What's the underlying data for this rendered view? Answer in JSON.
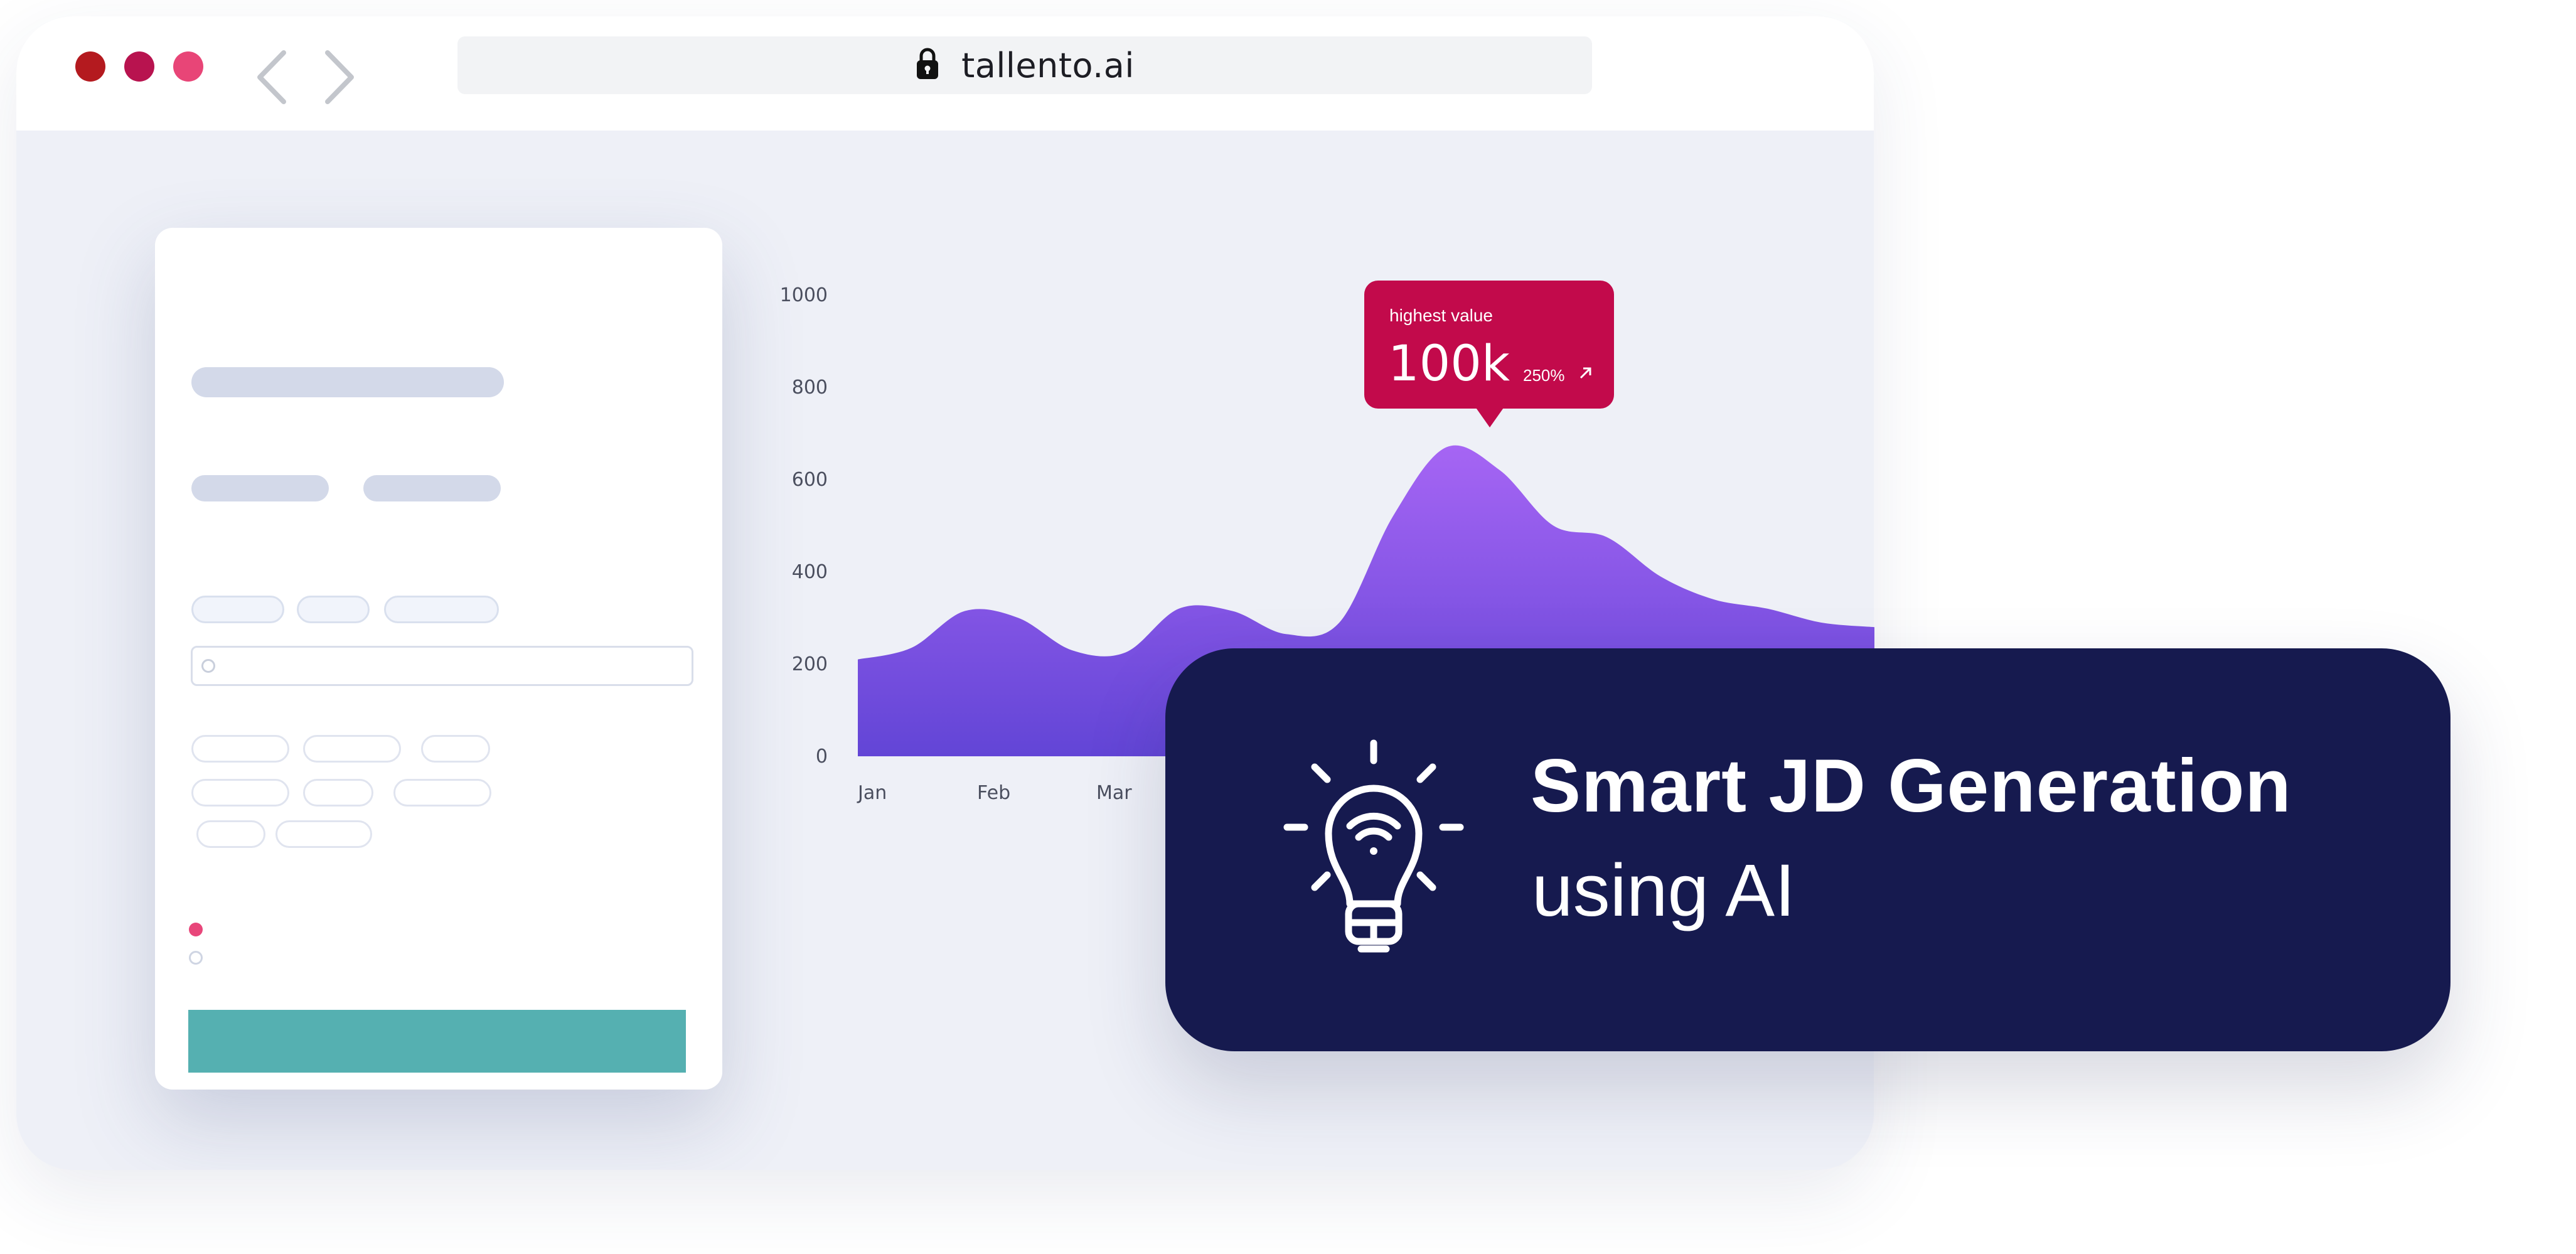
{
  "browser": {
    "url": "tallento.ai",
    "dot_colors": [
      "#b41a1f",
      "#b8134f",
      "#e84577"
    ],
    "lock_icon": "lock-icon"
  },
  "colors": {
    "area_top": "#a665f4",
    "area_bottom": "#6245d6",
    "tooltip": "#c20a4b",
    "submit": "#55b0b1",
    "feature_card": "#161a4f",
    "radio_selected": "#e8467a"
  },
  "chart_data": {
    "type": "area",
    "x": [
      "Jan",
      "Feb",
      "Mar"
    ],
    "y_ticks": [
      "1000",
      "800",
      "600",
      "400",
      "200",
      "0"
    ],
    "ylim": [
      0,
      1000
    ],
    "grid": false,
    "curve_points": [
      {
        "x": 0.0,
        "y": 210
      },
      {
        "x": 0.5,
        "y": 235
      },
      {
        "x": 1.0,
        "y": 315
      },
      {
        "x": 1.5,
        "y": 300
      },
      {
        "x": 2.0,
        "y": 230
      },
      {
        "x": 2.5,
        "y": 225
      },
      {
        "x": 3.0,
        "y": 320
      },
      {
        "x": 3.5,
        "y": 315
      },
      {
        "x": 4.0,
        "y": 265
      },
      {
        "x": 4.5,
        "y": 290
      },
      {
        "x": 5.0,
        "y": 520
      },
      {
        "x": 5.5,
        "y": 670
      },
      {
        "x": 6.0,
        "y": 620
      },
      {
        "x": 6.5,
        "y": 500
      },
      {
        "x": 7.0,
        "y": 475
      },
      {
        "x": 7.5,
        "y": 390
      },
      {
        "x": 8.0,
        "y": 340
      },
      {
        "x": 8.5,
        "y": 320
      },
      {
        "x": 9.0,
        "y": 290
      },
      {
        "x": 9.5,
        "y": 280
      }
    ],
    "annotation": {
      "label": "highest value",
      "value": "100k",
      "change": "250%",
      "change_icon": "arrow-up-right-icon"
    }
  },
  "feature": {
    "icon": "lightbulb-icon",
    "title": "Smart JD Generation",
    "subtitle": "using AI"
  }
}
